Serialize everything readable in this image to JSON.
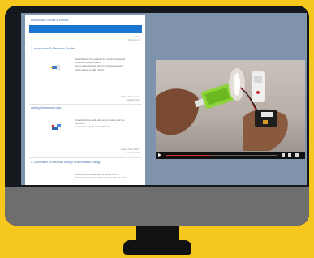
{
  "course": {
    "title": "Essentials: Circuits & Demos",
    "header_meta": [
      "Part 1",
      "Stepping 1/1"
    ]
  },
  "sections": [
    {
      "title": "1. Introduction To Electronic Circuits",
      "text": [
        "Dear Students! Do you know the central fundamental",
        "Important to build a Robot?",
        "",
        "Let us understand the Electronic Components and",
        "parts required to build a Robot."
      ],
      "meta": [
        "Page 1  File 1  Task 1",
        "Stepping 1/1 5"
      ]
    },
    {
      "title": "Adding Motors and Logic",
      "text": [
        "Hi and Welcome back. How can you make Logic into",
        "the Robot?",
        "",
        "Let us do it using the Control Remote."
      ],
      "meta": [
        "Page 1  File 1  Task 1",
        "Stepping 1/1 5"
      ]
    },
    {
      "title": "2. Conversion Of Electrical Energy to Mechanical Energy",
      "text": [
        "Would your be connecting and worked, isn't it",
        "Students you connect and join and more. Do you know"
      ],
      "meta": []
    }
  ],
  "video": {
    "progress": 0.4
  },
  "colors": {
    "background": "#f6c71c",
    "accent": "#1b76d3",
    "link": "#3b6dae"
  }
}
